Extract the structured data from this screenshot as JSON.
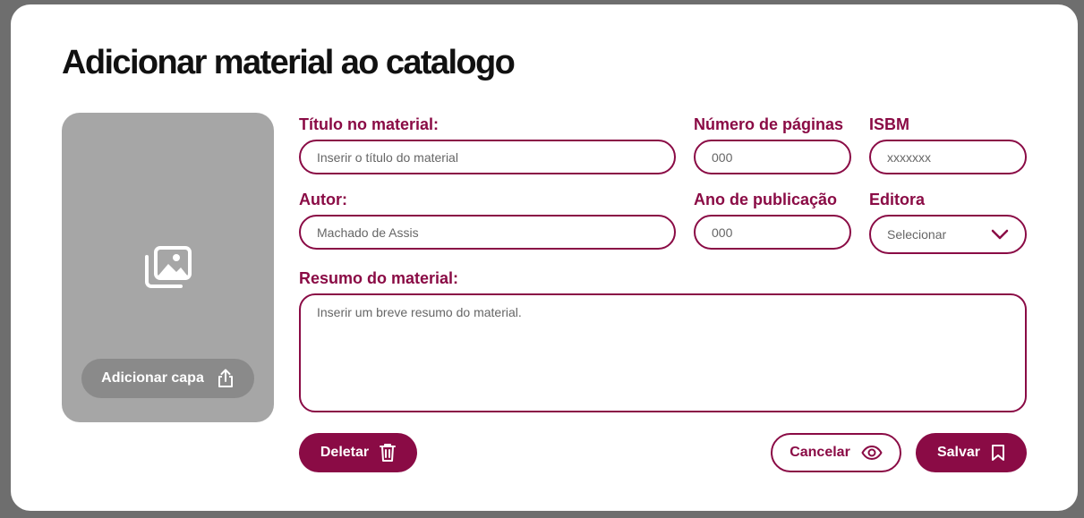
{
  "modal": {
    "title": "Adicionar material ao catalogo"
  },
  "cover": {
    "icon": "images-icon",
    "button_label": "Adicionar capa",
    "button_icon": "upload-icon"
  },
  "form": {
    "title": {
      "label": "Título no material:",
      "placeholder": "Inserir o título do material"
    },
    "pages": {
      "label": "Número de páginas",
      "placeholder": "000"
    },
    "isbn": {
      "label": "ISBM",
      "placeholder": "xxxxxxx"
    },
    "author": {
      "label": "Autor:",
      "value": "Machado de Assis"
    },
    "year": {
      "label": "Ano de publicação",
      "placeholder": "000"
    },
    "publisher": {
      "label": "Editora",
      "selected": "Selecionar"
    },
    "summary": {
      "label": "Resumo do material:",
      "placeholder": "Inserir um breve resumo do material."
    }
  },
  "actions": {
    "delete_label": "Deletar",
    "cancel_label": "Cancelar",
    "save_label": "Salvar"
  },
  "colors": {
    "accent": "#8a0b45",
    "cover_bg": "#a6a6a6",
    "cover_button_bg": "#8a8a8a",
    "overlay": "#6e6e6e"
  }
}
